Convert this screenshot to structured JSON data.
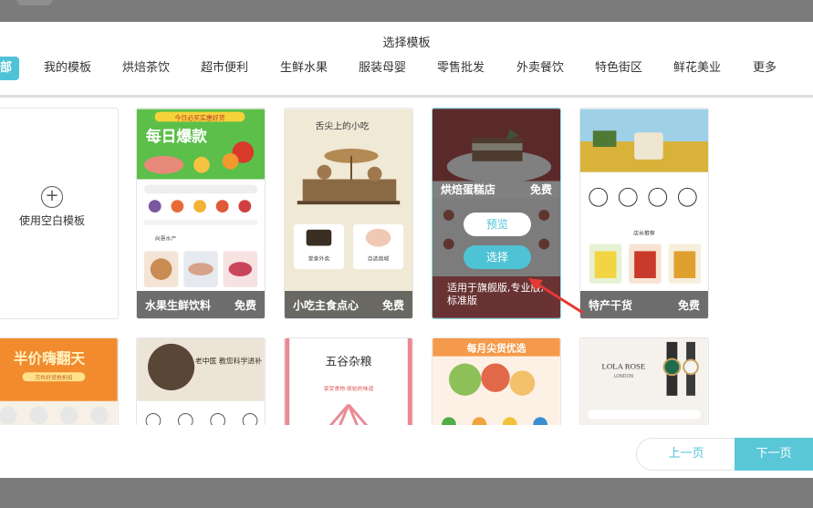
{
  "dialog": {
    "title": "选择模板"
  },
  "tabs": [
    {
      "label": "部",
      "active": true
    },
    {
      "label": "我的模板"
    },
    {
      "label": "烘焙茶饮"
    },
    {
      "label": "超市便利"
    },
    {
      "label": "生鲜水果"
    },
    {
      "label": "服装母婴"
    },
    {
      "label": "零售批发"
    },
    {
      "label": "外卖餐饮"
    },
    {
      "label": "特色街区"
    },
    {
      "label": "鲜花美业"
    },
    {
      "label": "更多"
    }
  ],
  "blank_template": {
    "label": "使用空白模板"
  },
  "templates": [
    {
      "name": "水果生鲜饮料",
      "price": "免费",
      "banner": "每日爆款",
      "tagline": "今日必买实惠好货",
      "section": "尚惠水产"
    },
    {
      "name": "小吃主食点心",
      "price": "免费",
      "banner": "舌尖上的小吃",
      "cat1": "堂食外卖",
      "cat2": "自选商城"
    },
    {
      "name": "烘焙蛋糕店",
      "price": "免费",
      "preview_label": "预览",
      "select_label": "选择",
      "description": "适用于旗舰版,专业版,标准版"
    },
    {
      "name": "特产干货",
      "price": "免费",
      "section": "店长推荐"
    }
  ],
  "templates_row2": [
    {
      "banner": "半价嗨翻天",
      "sub": "万件好货抢折扣"
    },
    {
      "banner": "老中医 教您科学进补"
    },
    {
      "banner": "五谷杂粮",
      "sub": "享受食物·原始的味道"
    },
    {
      "banner": "每月尖货优选"
    },
    {
      "banner": "LOLA ROSE",
      "sub": "LONDON"
    }
  ],
  "footer": {
    "prev_label": "上一页",
    "next_label": "下一页"
  },
  "colors": {
    "accent": "#4fc3d6",
    "overlay": "#3c3c3c",
    "arrow": "#e53935"
  }
}
